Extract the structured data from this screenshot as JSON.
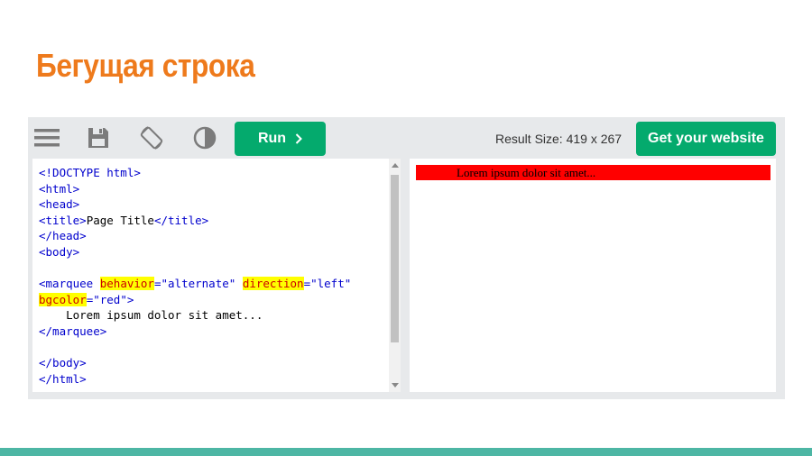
{
  "slide": {
    "title": "Бегущая строка"
  },
  "toolbar": {
    "icons": [
      "menu-icon",
      "save-icon",
      "rotate-icon",
      "contrast-icon"
    ],
    "run_label": "Run",
    "result_size": "Result Size: 419 x 267",
    "get_website_label": "Get your website"
  },
  "code": {
    "l1": "<!DOCTYPE html>",
    "l2_tag": "<html>",
    "l3_tag": "<head>",
    "l4_open": "<title>",
    "l4_text": "Page Title",
    "l4_close": "</title>",
    "l5_tag": "</head>",
    "l6_tag": "<body>",
    "l8_tag": "<marquee",
    "l8_attr1": "behavior",
    "l8_eq1": "=",
    "l8_val1": "\"alternate\"",
    "l8_attr2": "direction",
    "l8_eq2": "=",
    "l8_val2": "\"left\"",
    "l9_attr": "bgcolor",
    "l9_eq": "=",
    "l9_val": "\"red\"",
    "l9_close": ">",
    "l10_text": "    Lorem ipsum dolor sit amet...",
    "l11_tag": "</marquee>",
    "l13_tag": "</body>",
    "l14_tag": "</html>"
  },
  "result": {
    "marquee_text": "Lorem ipsum dolor sit amet..."
  },
  "colors": {
    "title": "#ee7a1c",
    "button": "#04aa6d",
    "marquee_bg": "#ff0000",
    "highlight": "#ffff00",
    "bottom_strip": "#4db6a4"
  }
}
